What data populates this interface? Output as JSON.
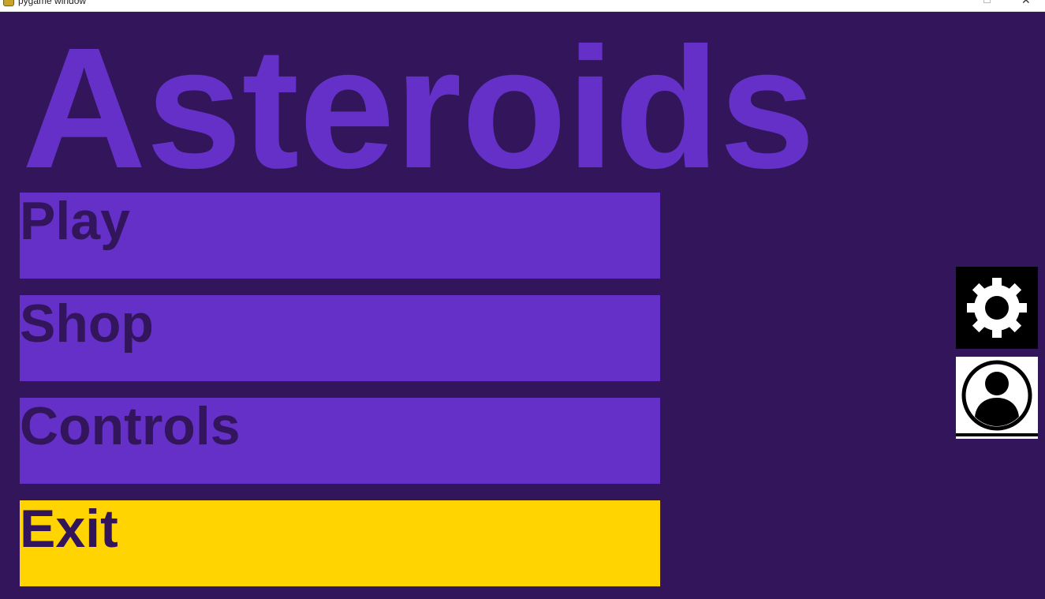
{
  "window": {
    "title": "pygame window"
  },
  "game": {
    "title": "Asteroids"
  },
  "menu": {
    "play_label": "Play",
    "shop_label": "Shop",
    "controls_label": "Controls",
    "exit_label": "Exit"
  },
  "side_buttons": {
    "settings_icon": "gear-icon",
    "profile_icon": "user-profile-icon"
  },
  "colors": {
    "background": "#32155b",
    "title": "#6530c8",
    "button": "#6530c8",
    "button_text": "#32155b",
    "exit_button": "#ffd400"
  }
}
